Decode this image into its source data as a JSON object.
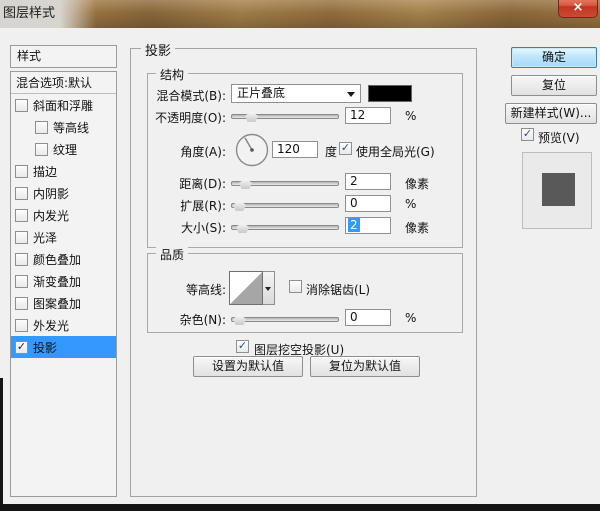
{
  "window": {
    "title": "图层样式",
    "close_glyph": "×"
  },
  "colors": {
    "selection_blue": "#3399ff",
    "blend_swatch": "#000000",
    "preview_square": "#595959",
    "titlebar_wood": "#9c7643",
    "close_red": "#c03522"
  },
  "sidebar": {
    "header": "样式",
    "blending_option": "混合选项:默认",
    "items": [
      {
        "label": "斜面和浮雕",
        "checked": false
      },
      {
        "label": "等高线",
        "checked": false
      },
      {
        "label": "纹理",
        "checked": false
      },
      {
        "label": "描边",
        "checked": false
      },
      {
        "label": "内阴影",
        "checked": false
      },
      {
        "label": "内发光",
        "checked": false
      },
      {
        "label": "光泽",
        "checked": false
      },
      {
        "label": "颜色叠加",
        "checked": false
      },
      {
        "label": "渐变叠加",
        "checked": false
      },
      {
        "label": "图案叠加",
        "checked": false
      },
      {
        "label": "外发光",
        "checked": false
      },
      {
        "label": "投影",
        "checked": true,
        "selected": true
      }
    ]
  },
  "panel": {
    "title": "投影",
    "structure": {
      "title": "结构",
      "blend_mode": {
        "label": "混合模式(B):",
        "value": "正片叠底"
      },
      "opacity": {
        "label": "不透明度(O):",
        "value": "12",
        "unit": "%"
      },
      "angle": {
        "label": "角度(A):",
        "value": "120",
        "unit": "度"
      },
      "global_light": {
        "label": "使用全局光(G)",
        "checked": true
      },
      "distance": {
        "label": "距离(D):",
        "value": "2",
        "unit": "像素"
      },
      "spread": {
        "label": "扩展(R):",
        "value": "0",
        "unit": "%"
      },
      "size": {
        "label": "大小(S):",
        "value": "2",
        "unit": "像素",
        "value_selected": true
      }
    },
    "quality": {
      "title": "品质",
      "contour_label": "等高线:",
      "antialias": {
        "label": "消除锯齿(L)",
        "checked": false
      },
      "noise": {
        "label": "杂色(N):",
        "value": "0",
        "unit": "%"
      }
    },
    "knockout": {
      "label": "图层挖空投影(U)",
      "checked": true
    },
    "footer_buttons": {
      "set_default": "设置为默认值",
      "reset_default": "复位为默认值"
    }
  },
  "actions": {
    "ok": "确定",
    "reset": "复位",
    "new_style": "新建样式(W)...",
    "preview": {
      "label": "预览(V)",
      "checked": true
    }
  }
}
